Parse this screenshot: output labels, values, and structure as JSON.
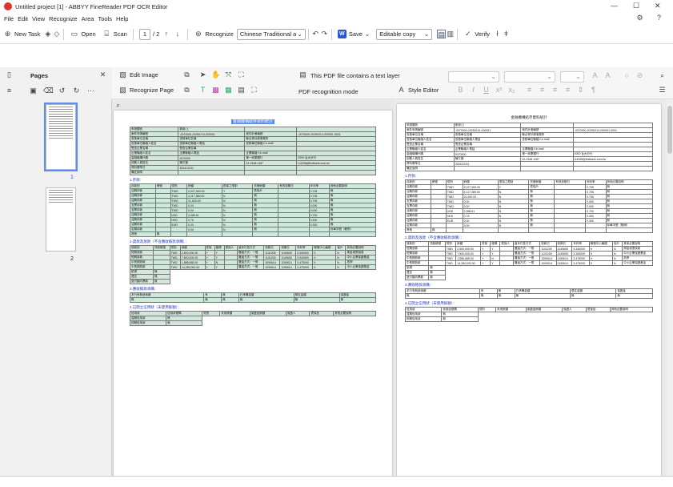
{
  "window": {
    "title": "Untitled project [1] - ABBYY FineReader PDF OCR Editor"
  },
  "menu": [
    "File",
    "Edit",
    "View",
    "Recognize",
    "Area",
    "Tools",
    "Help"
  ],
  "toolbar": {
    "new_task": "New Task",
    "open": "Open",
    "scan": "Scan",
    "page_current": "1",
    "page_total": "/ 2",
    "recognize": "Recognize",
    "language": "Chinese Traditional an",
    "save": "Save",
    "copy_mode": "Editable copy",
    "verify": "Verify"
  },
  "pages_panel": {
    "title": "Pages",
    "page1": "1",
    "page2": "2"
  },
  "image_toolbar": {
    "edit_image": "Edit Image",
    "recognize_page": "Recognize Page"
  },
  "notice": {
    "text": "This PDF file contains a text layer",
    "mode": "PDF recognition mode"
  },
  "text_toolbar": {
    "style_editor": "Style Editor"
  },
  "doc": {
    "title": "金融機構結存資料統計",
    "rows1": [
      [
        "申請類別",
        "新設/上",
        "",
        ""
      ],
      [
        "案件申請編號",
        "-0070000-20250214-000001",
        "案件計畫編號",
        "-0070000-20250214-000001-0001"
      ],
      [
        "查核單位名稱",
        "查核單位名稱",
        "聯合會計師事務所",
        ""
      ],
      [
        "查核單位聯絡人姓名",
        "查核單位聯絡人電話",
        "查核單位聯絡人e-mail",
        ""
      ],
      [
        "受查企業名稱",
        "受查企業名稱",
        "",
        ""
      ],
      [
        "企業聯絡人姓名",
        "企業聯絡人電話",
        "企業聯絡人e-mail",
        ""
      ],
      [
        "金融機構代碼",
        "0070000",
        "第一商業銀行",
        "0000 台大分行"
      ],
      [
        "回覆人員姓名",
        "陳又寶",
        "02-2348-1187",
        "l14208@firstbank.com.tw"
      ],
      [
        "資料基準日",
        "2024/12/31",
        "",
        ""
      ],
      [
        "備註說明",
        "",
        "",
        ""
      ]
    ],
    "sec1": "1.存款：",
    "dep_head": [
      "存款別",
      "帳號",
      "幣別",
      "餘額",
      "擔保之限制",
      "質借餘額",
      "有效到期日",
      "年利率",
      "其他必要說明"
    ],
    "deposits": [
      [
        "活期存款",
        "",
        "TWD",
        "2,027,963.00",
        "Y",
        "擔保戶",
        "",
        "0.705",
        "無"
      ],
      [
        "活期存款",
        "",
        "TWD",
        "4,117,389.00",
        "N",
        "無",
        "",
        "0.705",
        "無"
      ],
      [
        "活期存款",
        "",
        "TWD",
        "21,620.00",
        "N",
        "無",
        "",
        "0.705",
        "無"
      ],
      [
        "支票存款",
        "",
        "TWD",
        "0.00",
        "N",
        "無",
        "",
        "0.000",
        "無"
      ],
      [
        "支票存款",
        "",
        "TWD",
        "0.00",
        "N",
        "無",
        "",
        "0.000",
        "無"
      ],
      [
        "活期存款",
        "",
        "USD",
        "2,085.61",
        "N",
        "無",
        "",
        "0.700",
        "無"
      ],
      [
        "活期存款",
        "",
        "HKD",
        "0.76",
        "N",
        "無",
        "",
        "0.450",
        "無"
      ],
      [
        "活期存款",
        "",
        "EUR",
        "0.00",
        "N",
        "無",
        "",
        "0.300",
        "無"
      ],
      [
        "定期存款",
        "",
        "",
        "0.00",
        "N",
        "無",
        "",
        "",
        "存單字號（範例）"
      ],
      [
        "其他",
        "無",
        "",
        "",
        "",
        "",
        "",
        "",
        ""
      ]
    ],
    "sec2": "2.貸款及放款（不含應收帳款承購）：",
    "loan_head": [
      "放款別",
      "貸款帳號",
      "幣別",
      "餘額",
      "擔保",
      "循環",
      "擔保人",
      "還本付息方式",
      "放款日",
      "到期日",
      "年利率",
      "聯徵中心編號",
      "保戶",
      "其他必要說明"
    ],
    "loans": [
      [
        "短期放款",
        "",
        "TWD",
        "2,500,000.00",
        "Y",
        "Y",
        "",
        "攤還方式：一般",
        "1131205",
        "1140605",
        "3.340000",
        "9",
        "N",
        "周金或擔保卷"
      ],
      [
        "短期放款",
        "",
        "TWD",
        "7,500,000.00",
        "Y",
        "Y",
        "",
        "攤還方式：一般",
        "1131205",
        "1140605",
        "3.340000",
        "9",
        "N",
        "中小企業保證基金"
      ],
      [
        "中長期放款",
        "",
        "TWD",
        "1,586,668.00",
        "Y",
        "N",
        "",
        "攤還方式：一般",
        "1090614",
        "1150614",
        "3.475000",
        "9",
        "N",
        "抵押"
      ],
      [
        "中長期放款",
        "",
        "TWD",
        "14,280,000.00",
        "Y",
        "Y",
        "",
        "攤還方式：一般",
        "1090614",
        "1150614",
        "3.475000",
        "9",
        "N",
        "中小企業保證基金"
      ]
    ],
    "loan_extra": [
      [
        "貼現",
        "無"
      ],
      [
        "透支",
        "無"
      ],
      [
        "墊付國內票款",
        "無"
      ]
    ],
    "sec3": "3.應收帳款承購：",
    "sec4": "4.已開立信用狀（未使用餘額）：",
    "lc_head": [
      "信用狀",
      "信用狀號碼",
      "幣別",
      "未用餘額",
      "保證金餘額",
      "保證人",
      "擔保品",
      "其他必要說明"
    ],
    "lc_rows": [
      [
        "遠期信用狀",
        "無"
      ],
      [
        "即期信用狀",
        "無"
      ]
    ]
  }
}
